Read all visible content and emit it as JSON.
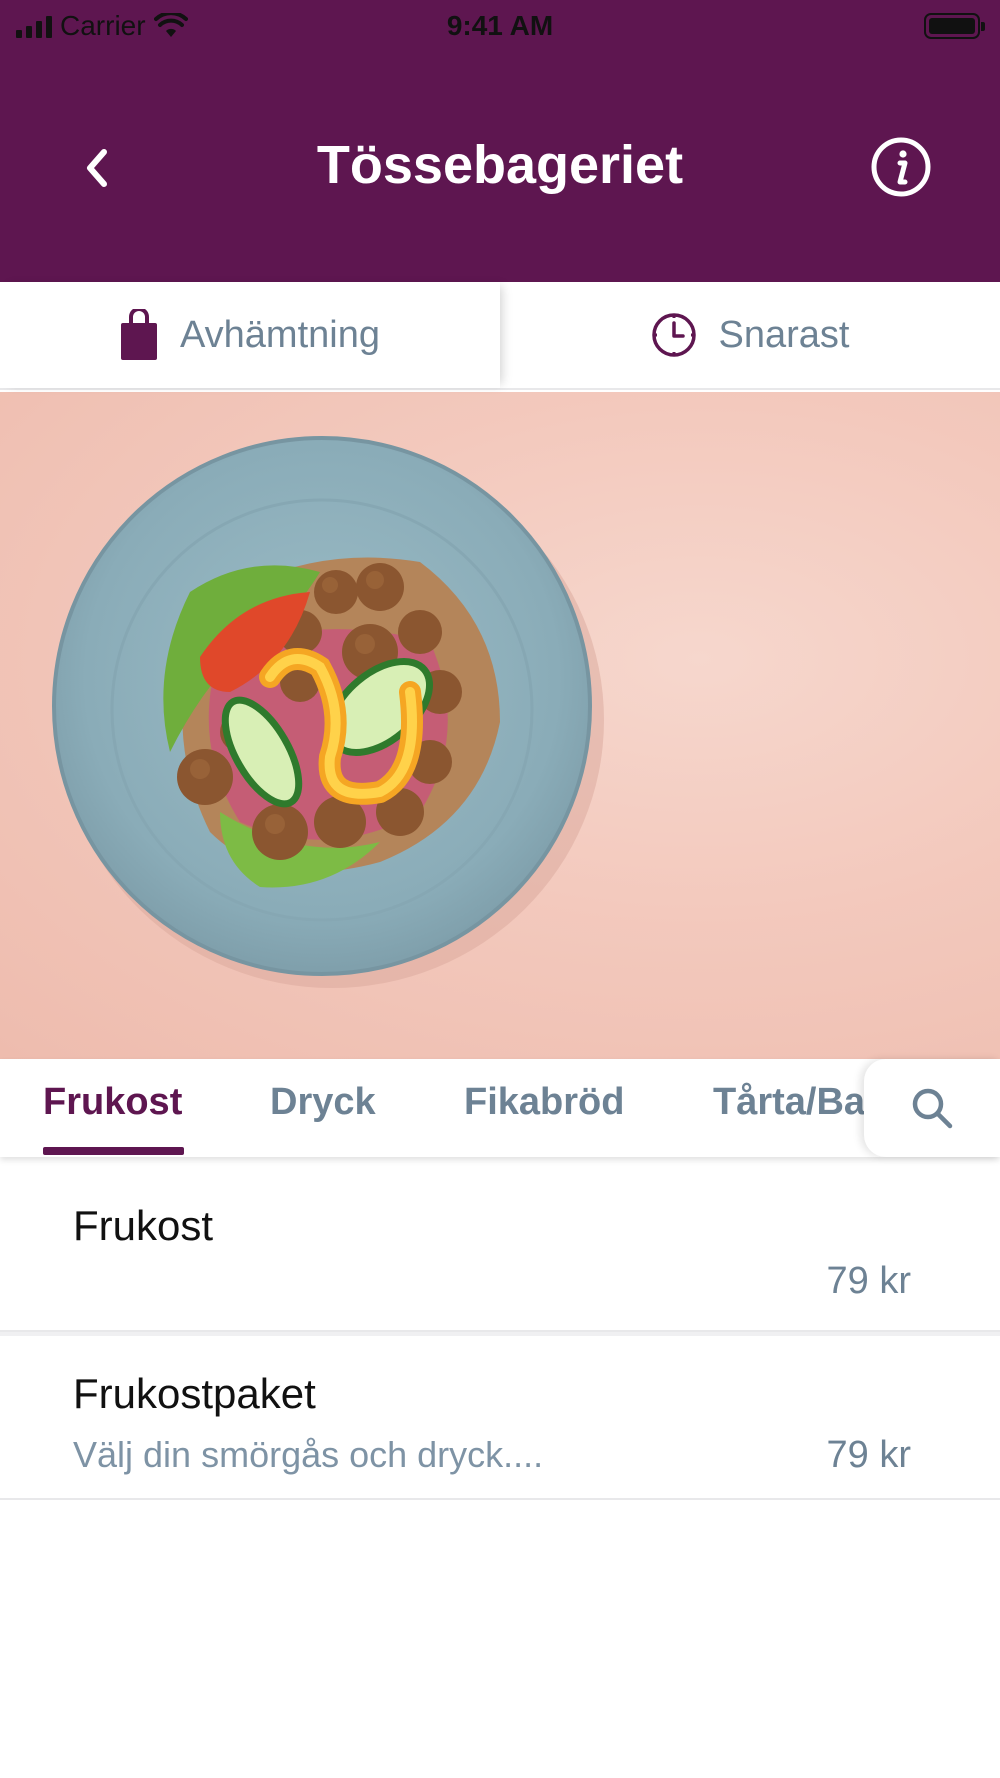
{
  "status_bar": {
    "carrier": "Carrier",
    "time": "9:41 AM"
  },
  "header": {
    "title": "Tössebageriet",
    "back_icon": "chevron-left-icon",
    "info_icon": "info-icon"
  },
  "mode_bar": {
    "pickup_label": "Avhämtning",
    "pickup_icon": "shopping-bag-icon",
    "time_label": "Snarast",
    "time_icon": "clock-icon"
  },
  "hero": {
    "image": "plate-meatball-sandwich-photo"
  },
  "tabs": {
    "items": [
      {
        "label": "Frukost",
        "active": true
      },
      {
        "label": "Dryck",
        "active": false
      },
      {
        "label": "Fikabröd",
        "active": false
      },
      {
        "label": "Tårta/Bakelse",
        "active": false
      }
    ],
    "search_icon": "search-icon"
  },
  "menu": [
    {
      "name": "Frukost",
      "description": "",
      "price": "79 kr"
    },
    {
      "name": "Frukostpaket",
      "description": "Välj din smörgås och dryck....",
      "price": "79 kr"
    }
  ],
  "colors": {
    "brand": "#5e1650",
    "muted_text": "#6d8294",
    "hero_bg": "#f3c9bd",
    "plate": "#8fb0bb"
  }
}
